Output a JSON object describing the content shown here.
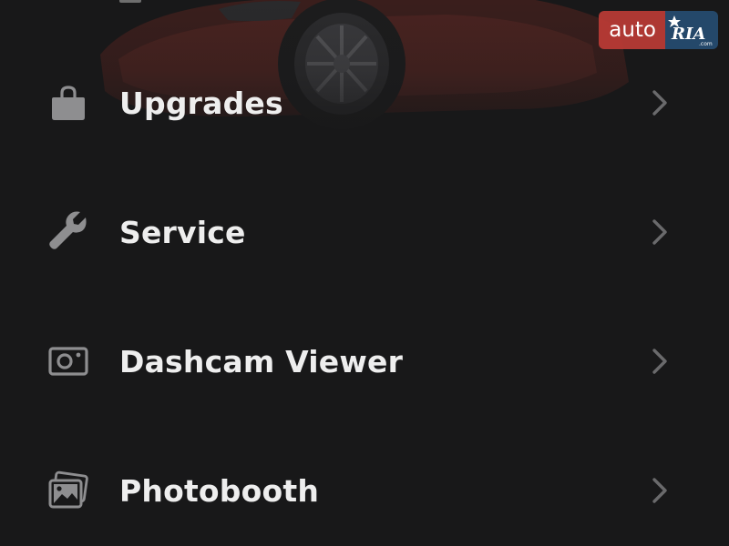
{
  "watermark": {
    "left_text": "auto",
    "right_text": "RIA",
    "right_subtext": ".com"
  },
  "colors": {
    "background": "#181819",
    "label": "#eeeeee",
    "icon": "#8e8e90",
    "chevron": "#6a6a6c",
    "watermark_red": "#c33c37",
    "watermark_blue": "#264e73"
  },
  "hero": {
    "icon": "car-image"
  },
  "menu": {
    "items": [
      {
        "label": "Upgrades",
        "icon": "shopping-bag-icon"
      },
      {
        "label": "Service",
        "icon": "wrench-icon"
      },
      {
        "label": "Dashcam Viewer",
        "icon": "dashcam-icon"
      },
      {
        "label": "Photobooth",
        "icon": "photos-icon"
      }
    ],
    "chevron_icon": "chevron-right-icon"
  }
}
